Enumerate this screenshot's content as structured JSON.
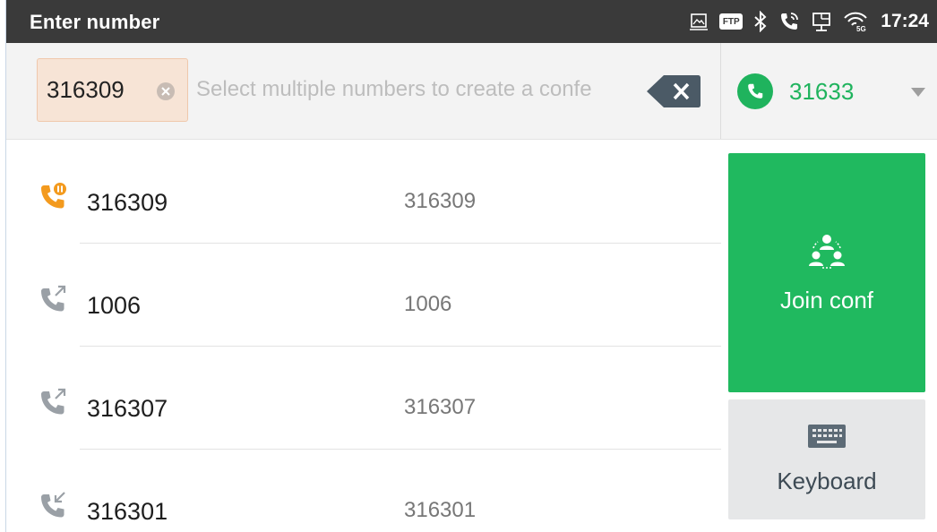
{
  "statusbar": {
    "title": "Enter number",
    "ftp_badge": "FTP",
    "time": "17:24",
    "icons": [
      "screenshot-icon",
      "ftp-icon",
      "bluetooth-icon",
      "call-icon",
      "network-icon",
      "wifi-5g-icon"
    ]
  },
  "input": {
    "chip_label": "316309",
    "placeholder": "Select multiple numbers to create a confe",
    "account_number": "31633"
  },
  "rows": [
    {
      "name": "316309",
      "number": "316309",
      "icon": "call-hold-icon",
      "icon_color": "#f39a1e"
    },
    {
      "name": "1006",
      "number": "1006",
      "icon": "outgoing-call-icon",
      "icon_color": "#9aa0a6"
    },
    {
      "name": "316307",
      "number": "316307",
      "icon": "outgoing-call-icon",
      "icon_color": "#9aa0a6"
    },
    {
      "name": "316301",
      "number": "316301",
      "icon": "incoming-call-icon",
      "icon_color": "#9aa0a6"
    }
  ],
  "actions": {
    "join_label": "Join conf",
    "keyboard_label": "Keyboard"
  },
  "colors": {
    "accent_green": "#20b95f",
    "hold_orange": "#f39a1e",
    "chip_bg": "#f7e4d6"
  }
}
